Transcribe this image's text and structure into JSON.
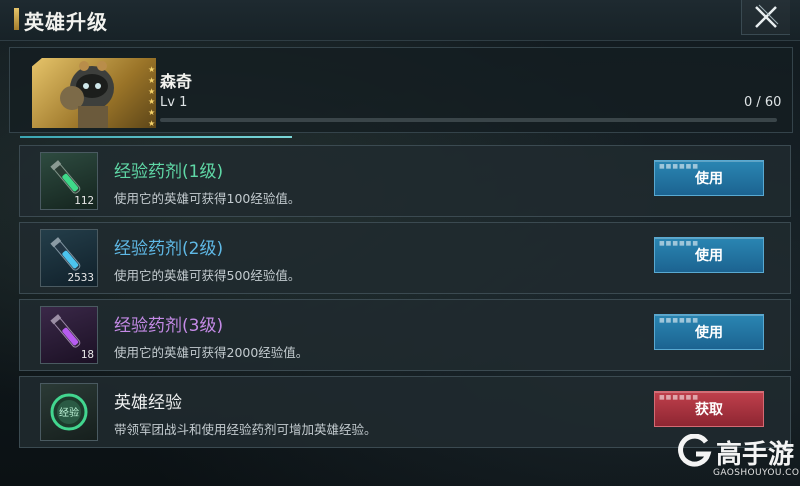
{
  "header": {
    "title": "英雄升级"
  },
  "hero": {
    "name": "森奇",
    "level": "Lv 1",
    "exp": "0 / 60",
    "exp_progress": 0,
    "stars": 6
  },
  "items": [
    {
      "name": "经验药剂(1级)",
      "desc": "使用它的英雄可获得100经验值。",
      "count": "112",
      "button": "使用",
      "name_color": "#5fd8a6",
      "accent": "#3fd98a"
    },
    {
      "name": "经验药剂(2级)",
      "desc": "使用它的英雄可获得500经验值。",
      "count": "2533",
      "button": "使用",
      "name_color": "#5fb9e6",
      "accent": "#4cc4ee"
    },
    {
      "name": "经验药剂(3级)",
      "desc": "使用它的英雄可获得2000经验值。",
      "count": "18",
      "button": "使用",
      "name_color": "#c48ae6",
      "accent": "#b75cf0"
    },
    {
      "name": "英雄经验",
      "desc": "带领军团战斗和使用经验药剂可增加英雄经验。",
      "icon_text": "经验",
      "button": "获取",
      "name_color": "#eef0f0",
      "accent": "#42d68f"
    }
  ],
  "watermark": {
    "brand": "高手游",
    "url": "GAOSHOUYOU.COM"
  }
}
